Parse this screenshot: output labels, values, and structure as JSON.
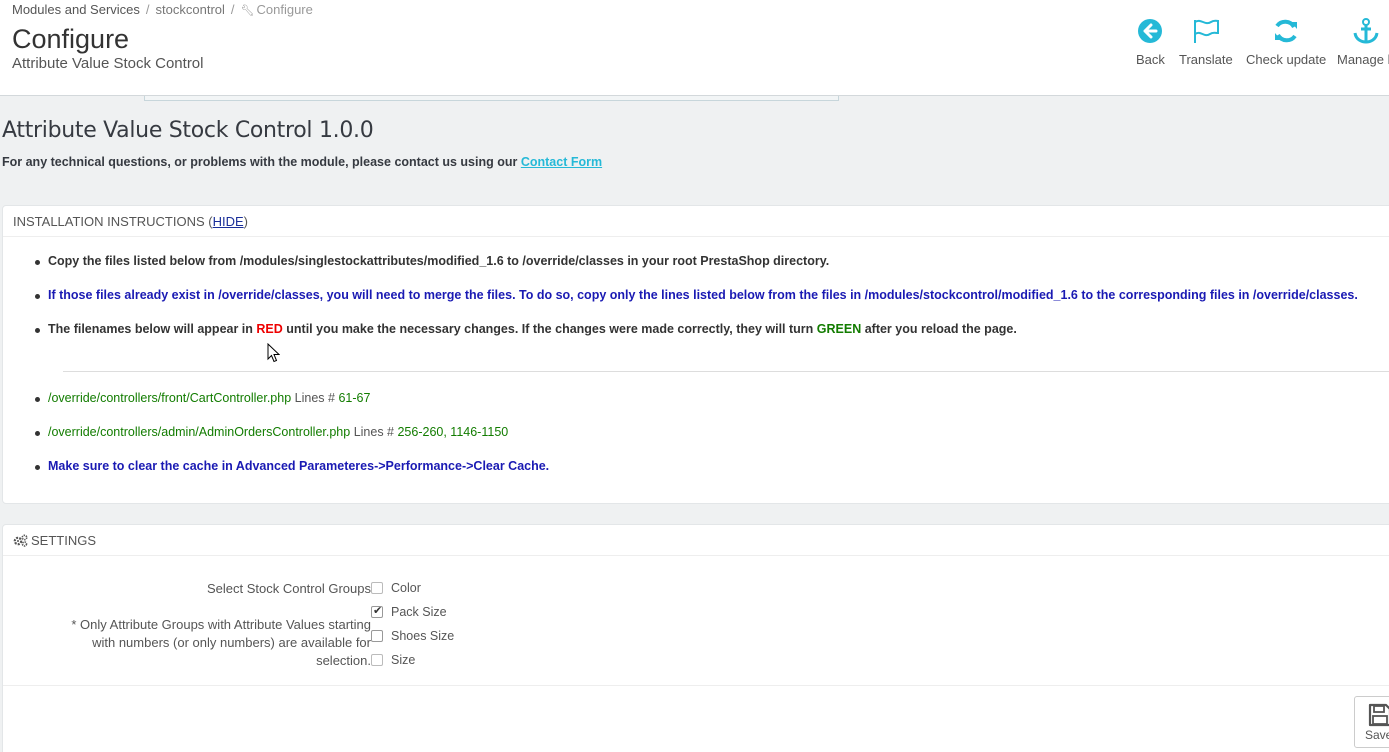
{
  "breadcrumb": {
    "root": "Modules and Services",
    "module": "stockcontrol",
    "current": "Configure"
  },
  "header": {
    "title": "Configure",
    "subtitle": "Attribute Value Stock Control"
  },
  "toolbar": {
    "back": "Back",
    "translate": "Translate",
    "check_update": "Check update",
    "manage_hooks": "Manage h"
  },
  "module": {
    "title": "Attribute Value Stock Control 1.0.0",
    "contact_text": "For any technical questions, or problems with the module, please contact us using our ",
    "contact_link": "Contact Form"
  },
  "instructions": {
    "heading_text": "INSTALLATION INSTRUCTIONS (",
    "hide_link": "HIDE",
    "heading_close": ")",
    "item1": "Copy the files listed below from /modules/singlestockattributes/modified_1.6 to /override/classes in your root PrestaShop directory.",
    "item2": "If those files already exist in /override/classes, you will need to merge the files. To do so, copy only the lines listed below from the files in /modules/stockcontrol/modified_1.6 to the corresponding files in /override/classes.",
    "item3_a": "The filenames below will appear in ",
    "item3_red": "RED",
    "item3_b": " until you make the necessary changes. If the changes were made correctly, they will turn ",
    "item3_green": "GREEN",
    "item3_c": " after you reload the page.",
    "files": [
      {
        "path": "/override/controllers/front/CartController.php",
        "lines_label": " Lines # ",
        "lines": "61-67"
      },
      {
        "path": "/override/controllers/admin/AdminOrdersController.php",
        "lines_label": " Lines # ",
        "lines": "256-260, 1146-1150"
      }
    ],
    "cache_note": "Make sure to clear the cache in Advanced Parameteres->Performance->Clear Cache."
  },
  "settings": {
    "heading": "SETTINGS",
    "label": "Select Stock Control Groups",
    "help_line1": "* Only Attribute Groups with Attribute Values starting",
    "help_line2": "with numbers (or only numbers) are available for",
    "help_line3": "selection.",
    "options": [
      {
        "label": "Color",
        "checked": false,
        "disabled": true
      },
      {
        "label": "Pack Size",
        "checked": true,
        "disabled": false
      },
      {
        "label": "Shoes Size",
        "checked": false,
        "disabled": false
      },
      {
        "label": "Size",
        "checked": false,
        "disabled": true
      }
    ],
    "save": "Save"
  },
  "colors": {
    "accent": "#25b9d7",
    "red": "#ee0000",
    "green": "#127c00",
    "blue_text": "#1a1ab3"
  }
}
